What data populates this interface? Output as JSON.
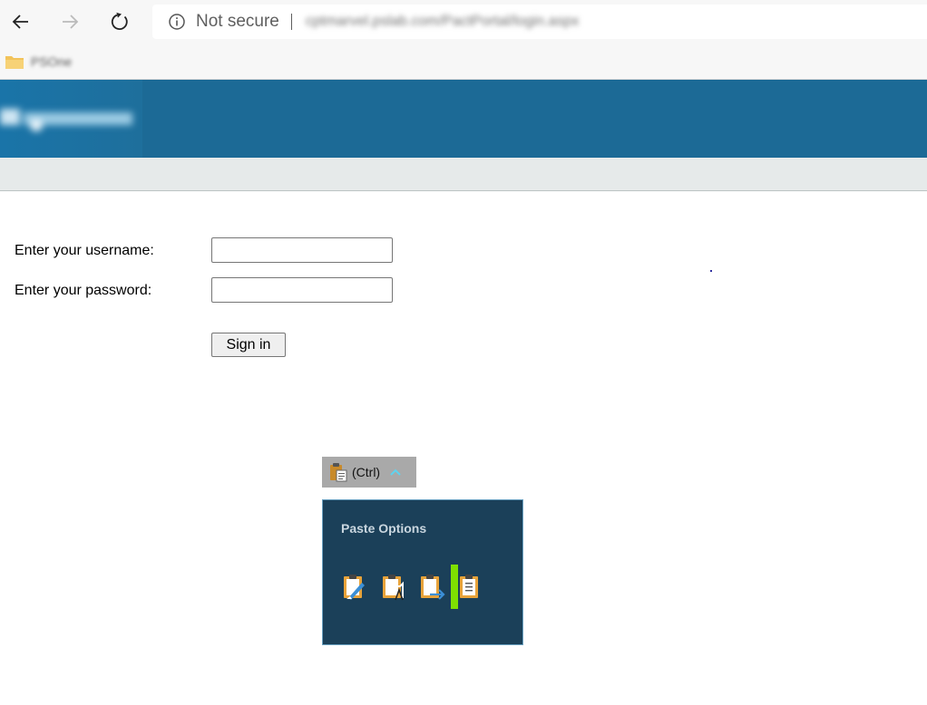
{
  "browser": {
    "address": {
      "security_label": "Not secure",
      "url": "cptmarvel.pslab.com/PactPortal/login.aspx"
    },
    "favorites": {
      "items": [
        {
          "label": "PSOne"
        }
      ]
    }
  },
  "login": {
    "username_label": "Enter your username:",
    "password_label": "Enter your password:",
    "username_value": "",
    "password_value": "",
    "signin_label": "Sign in"
  },
  "paste": {
    "ctrl_label": "(Ctrl)",
    "title": "Paste Options",
    "options": [
      {
        "icon": "paste-keep-source-formatting-icon"
      },
      {
        "icon": "paste-merge-formatting-icon"
      },
      {
        "icon": "paste-picture-icon"
      },
      {
        "icon": "paste-keep-text-only-icon"
      }
    ],
    "highlight_color": "#7fe000"
  },
  "colors": {
    "header": "#1c6a96",
    "subheader": "#e6eaea",
    "paste_panel": "#1b4059"
  }
}
